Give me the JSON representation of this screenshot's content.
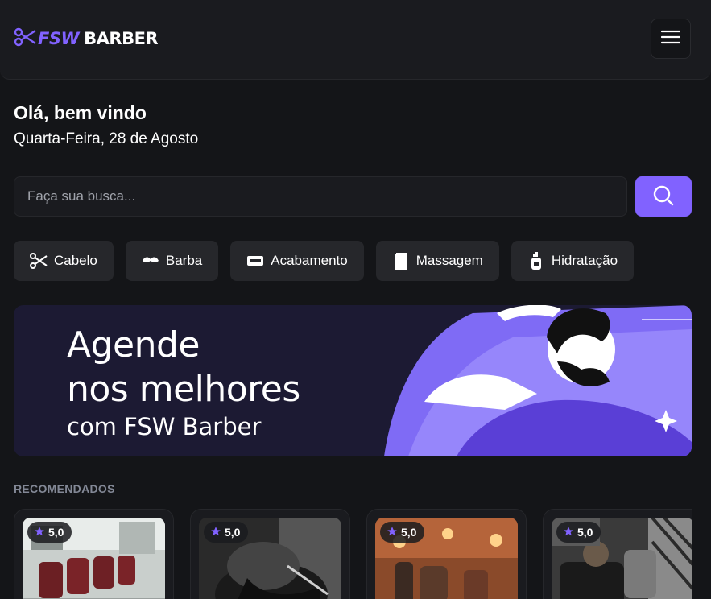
{
  "header": {
    "logo_brand": "FSW",
    "logo_text": "BARBER"
  },
  "greeting": {
    "title": "Olá, bem vindo",
    "date": "Quarta-Feira, 28 de Agosto"
  },
  "search": {
    "placeholder": "Faça sua busca..."
  },
  "categories": [
    {
      "label": "Cabelo",
      "icon": "scissors-icon"
    },
    {
      "label": "Barba",
      "icon": "mustache-icon"
    },
    {
      "label": "Acabamento",
      "icon": "razor-icon"
    },
    {
      "label": "Massagem",
      "icon": "towel-icon"
    },
    {
      "label": "Hidratação",
      "icon": "bottle-icon"
    }
  ],
  "banner": {
    "line1": "Agende",
    "line2": "nos melhores",
    "line3": "com FSW Barber"
  },
  "recommended": {
    "title": "RECOMENDADOS",
    "items": [
      {
        "rating": "5,0"
      },
      {
        "rating": "5,0"
      },
      {
        "rating": "5,0"
      },
      {
        "rating": "5,0"
      }
    ]
  },
  "colors": {
    "background": "#141518",
    "surface": "#1a1b1f",
    "accent": "#8162ff",
    "chip": "#26272b"
  }
}
